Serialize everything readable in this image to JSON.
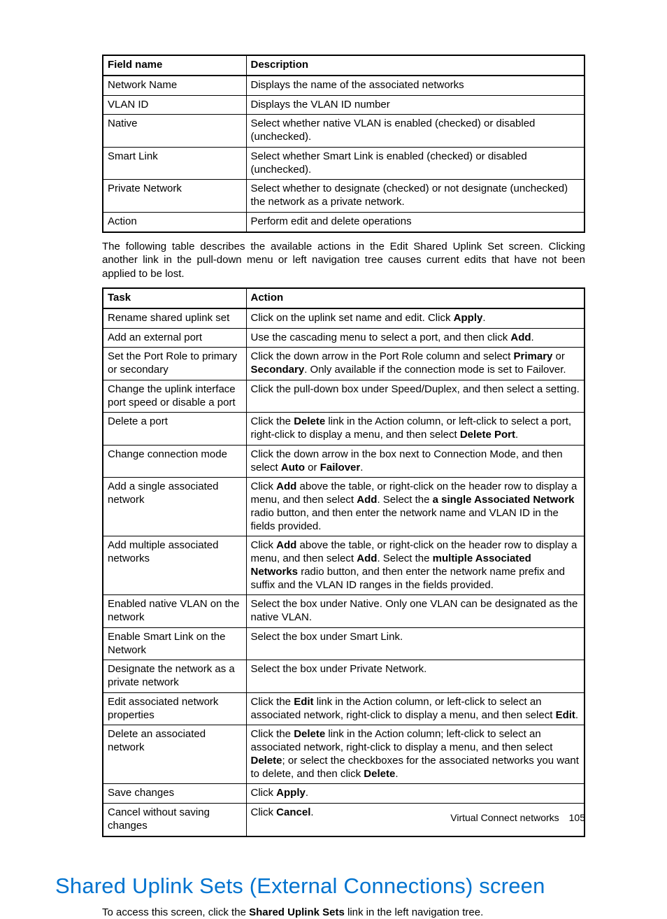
{
  "table1": {
    "headers": {
      "field": "Field name",
      "desc": "Description"
    },
    "rows": [
      {
        "field": "Network Name",
        "desc": "Displays the name of the associated networks"
      },
      {
        "field": "VLAN ID",
        "desc": "Displays the VLAN ID number"
      },
      {
        "field": "Native",
        "desc": "Select whether native VLAN is enabled (checked) or disabled (unchecked)."
      },
      {
        "field": "Smart Link",
        "desc": "Select whether Smart Link is enabled (checked) or disabled (unchecked)."
      },
      {
        "field": "Private Network",
        "desc": "Select whether to designate (checked) or not designate (unchecked) the network as a private network."
      },
      {
        "field": "Action",
        "desc": "Perform edit and delete operations"
      }
    ]
  },
  "para1": "The following table describes the available actions in the Edit Shared Uplink Set screen. Clicking another link in the pull-down menu or left navigation tree causes current edits that have not been applied to be lost.",
  "table2": {
    "headers": {
      "task": "Task",
      "action": "Action"
    },
    "rows": [
      {
        "task": "Rename shared uplink set",
        "action_html": "Click on the uplink set name and edit. Click <b>Apply</b>."
      },
      {
        "task": "Add an external port",
        "action_html": "Use the cascading menu to select a port, and then click <b>Add</b>."
      },
      {
        "task": "Set the Port Role to primary or secondary",
        "action_html": "Click the down arrow in the Port Role column and select <b>Primary</b> or <b>Secondary</b>. Only available if the connection mode is set to Failover."
      },
      {
        "task": "Change the uplink interface port speed or disable a port",
        "action_html": "Click the pull-down box under Speed/Duplex, and then select a setting."
      },
      {
        "task": "Delete a port",
        "action_html": "Click the <b>Delete</b> link in the Action column, or left-click to select a port, right-click to display a menu, and then select <b>Delete Port</b>."
      },
      {
        "task": "Change connection mode",
        "action_html": "Click the down arrow in the box next to Connection Mode, and then select <b>Auto</b> or <b>Failover</b>."
      },
      {
        "task": "Add a single associated network",
        "action_html": "Click <b>Add</b> above the table, or right-click on the header row to display a menu, and then select <b>Add</b>. Select the <b>a single Associated Network</b> radio button, and then enter the network name and VLAN ID in the fields provided."
      },
      {
        "task": "Add multiple associated networks",
        "action_html": "Click <b>Add</b> above the table, or right-click on the header row to display a menu, and then select <b>Add</b>. Select the <b>multiple Associated Networks</b> radio button, and then enter the network name prefix and suffix and the VLAN ID ranges in the fields provided."
      },
      {
        "task": "Enabled native VLAN on the network",
        "action_html": "Select the box under Native. Only one VLAN can be designated as the native VLAN."
      },
      {
        "task": "Enable Smart Link on the Network",
        "action_html": "Select the box under Smart Link."
      },
      {
        "task": "Designate the network as a private network",
        "action_html": "Select the box under Private Network."
      },
      {
        "task": "Edit associated network properties",
        "action_html": "Click the <b>Edit</b> link in the Action column, or left-click to select an associated network, right-click to display a menu, and then select <b>Edit</b>."
      },
      {
        "task": "Delete an associated network",
        "action_html": "Click the <b>Delete</b> link in the Action column; left-click to select an associated network, right-click to display a menu, and then select <b>Delete</b>; or select the checkboxes for the associated networks you want to delete, and then click <b>Delete</b>."
      },
      {
        "task": "Save changes",
        "action_html": "Click <b>Apply</b>."
      },
      {
        "task": "Cancel without saving changes",
        "action_html": "Click <b>Cancel</b>."
      }
    ]
  },
  "heading": "Shared Uplink Sets (External Connections) screen",
  "para2_parts": {
    "pre": "To access this screen, click the ",
    "bold": "Shared Uplink Sets",
    "post": " link in the left navigation tree."
  },
  "footer": {
    "section": "Virtual Connect networks",
    "page": "105"
  }
}
